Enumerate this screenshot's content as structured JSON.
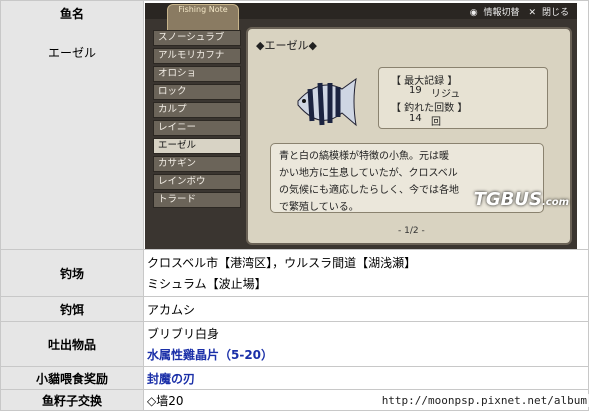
{
  "labels": {
    "fish_name": "鱼名",
    "fish_name_value": "エーゼル",
    "spot": "钓场",
    "bait": "钓饵",
    "drop": "吐出物品",
    "cat": "小貓喂食奖励",
    "egg": "鱼籽子交换"
  },
  "values": {
    "spot_line1": "クロスベル市【港湾区】，ウルスラ間道【湖浅瀬】",
    "spot_line2": "ミシュラム【波止場】",
    "bait": "アカムシ",
    "drop_line1": "ブリブリ白身",
    "drop_line2": "水属性雞晶片（5-20）",
    "cat": "封魔の刃",
    "egg": "◇墙20"
  },
  "game": {
    "tab_label": "Fishing Note",
    "toggle": "情報切替",
    "close": "閉じる",
    "list": [
      "スノーシュラブ",
      "アルモリカフナ",
      "オロショ",
      "ロック",
      "カルプ",
      "レイニー",
      "エーゼル",
      "カサギン",
      "レインボウ",
      "トラード"
    ],
    "selected_index": 6,
    "panel_name": "◆エーゼル◆",
    "record_title": "【 最大記録 】",
    "record_value": "19",
    "record_unit": "リジュ",
    "count_title": "【 釣れた回数 】",
    "count_value": "14",
    "count_unit": "回",
    "desc_line1": "青と白の縞模様が特徴の小魚。元は暖",
    "desc_line2": "かい地方に生息していたが、クロスベル",
    "desc_line3": "の気候にも適応したらしく、今では各地",
    "desc_line4": "で繁殖している。",
    "pager": "- 1/2 -",
    "watermark": "TGBUS",
    "watermark_suffix": ".com"
  },
  "footer_url": "http://moonpsp.pixnet.net/album",
  "colors": {
    "label_bg": "#e6e6e6",
    "link_blue": "#1a2fa8"
  }
}
